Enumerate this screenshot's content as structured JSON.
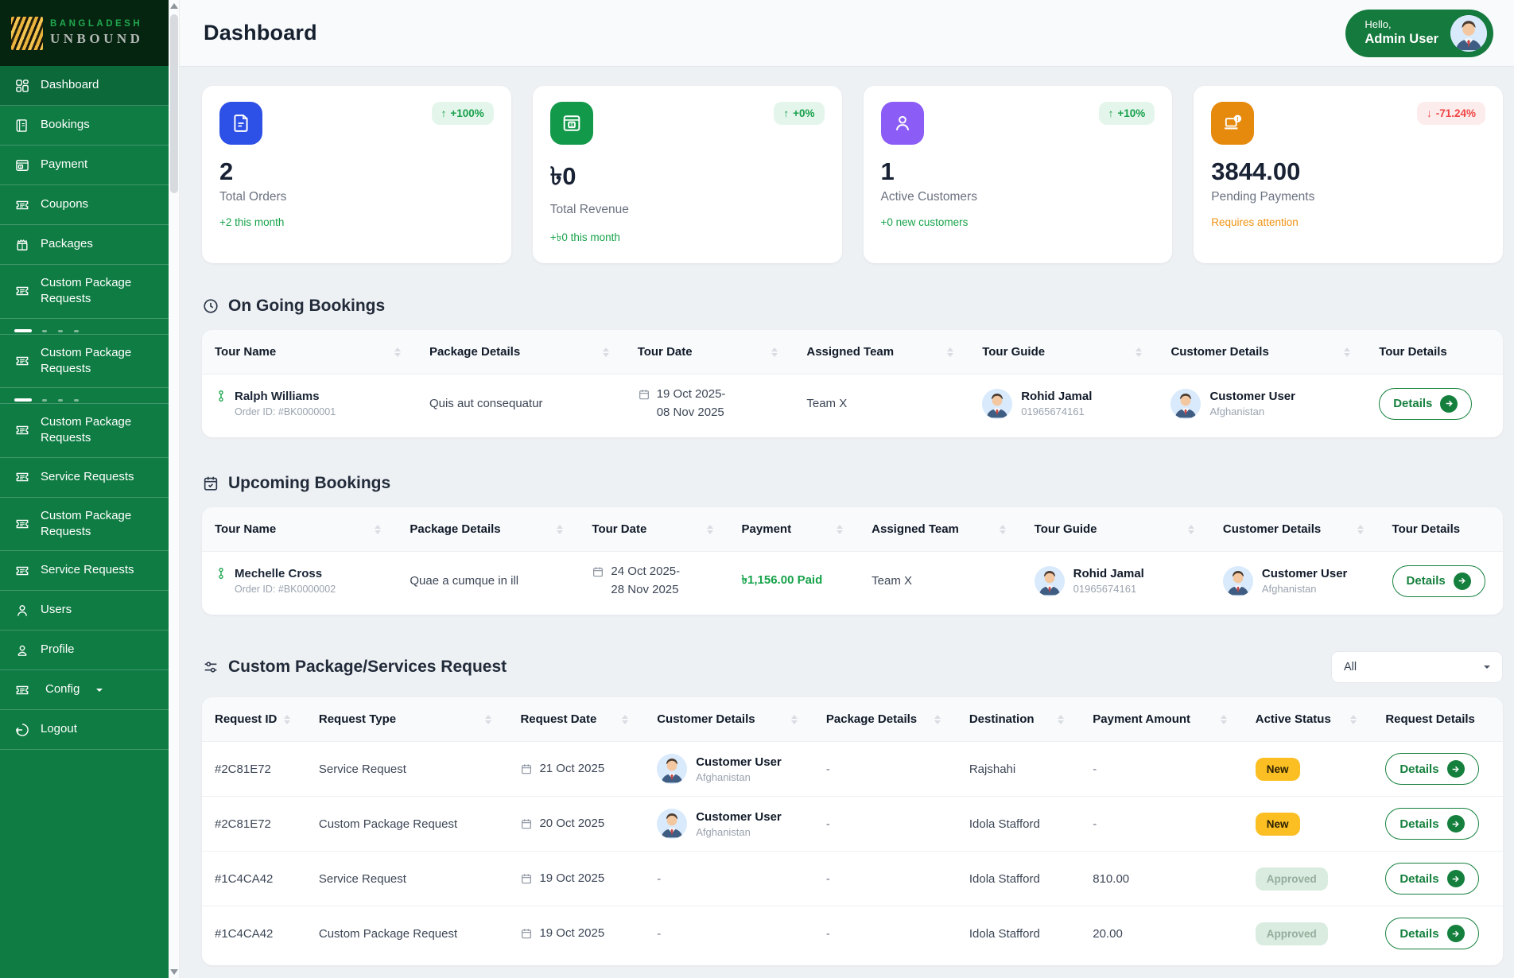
{
  "brand": {
    "top": "BANGLADESH",
    "bottom": "UNBOUND"
  },
  "header": {
    "title": "Dashboard",
    "greeting": "Hello,",
    "user_name": "Admin User"
  },
  "sidebar": {
    "items": [
      {
        "label": "Dashboard",
        "icon": "grid-icon"
      },
      {
        "label": "Bookings",
        "icon": "book-icon"
      },
      {
        "label": "Payment",
        "icon": "payment-icon"
      },
      {
        "label": "Coupons",
        "icon": "ticket-icon"
      },
      {
        "label": "Packages",
        "icon": "gift-icon"
      },
      {
        "label": "Custom Package Requests",
        "icon": "ticket-icon"
      },
      {
        "label": "",
        "icon": "clipped-item"
      },
      {
        "label": "Custom Package Requests",
        "icon": "ticket-icon"
      },
      {
        "label": "",
        "icon": "clipped-item"
      },
      {
        "label": "Custom Package Requests",
        "icon": "ticket-icon"
      },
      {
        "label": "Service Requests",
        "icon": "ticket-icon"
      },
      {
        "label": "Custom Package Requests",
        "icon": "ticket-icon"
      },
      {
        "label": "Service Requests",
        "icon": "ticket-icon"
      },
      {
        "label": "Users",
        "icon": "user-icon"
      },
      {
        "label": "Profile",
        "icon": "profile-icon"
      },
      {
        "label": "Config",
        "icon": "ticket-icon"
      },
      {
        "label": "Logout",
        "icon": "logout-icon"
      }
    ]
  },
  "stats": [
    {
      "badge_dir": "↑",
      "badge": "+100%",
      "value": "2",
      "label": "Total Orders",
      "footer": "+2 this month",
      "icon": "invoice-icon",
      "icon_color": "#2d50e6",
      "trend": "up"
    },
    {
      "badge_dir": "↑",
      "badge": "+0%",
      "value": "৳0",
      "label": "Total Revenue",
      "footer": "+৳0 this month",
      "icon": "revenue-icon",
      "icon_color": "#12994a",
      "trend": "up"
    },
    {
      "badge_dir": "↑",
      "badge": "+10%",
      "value": "1",
      "label": "Active Customers",
      "footer": "+0 new customers",
      "icon": "customer-icon",
      "icon_color": "#8b5cf6",
      "trend": "up"
    },
    {
      "badge_dir": "↓",
      "badge": "-71.24%",
      "value": "3844.00",
      "label": "Pending Payments",
      "footer": "Requires attention",
      "icon": "laptop-alert-icon",
      "icon_color": "#e68a0d",
      "trend": "down"
    }
  ],
  "ongoing": {
    "title": "On Going Bookings",
    "columns": [
      "Tour Name",
      "Package Details",
      "Tour Date",
      "Assigned Team",
      "Tour Guide",
      "Customer Details",
      "Tour Details"
    ],
    "row": {
      "name": "Ralph Williams",
      "order_id": "Order ID: #BK0000001",
      "package": "Quis aut consequatur",
      "date_line1": "19 Oct 2025-",
      "date_line2": "08 Nov 2025",
      "team": "Team X",
      "guide_name": "Rohid Jamal",
      "guide_phone": "01965674161",
      "customer_name": "Customer User",
      "customer_location": "Afghanistan"
    }
  },
  "upcoming": {
    "title": "Upcoming Bookings",
    "columns": [
      "Tour Name",
      "Package Details",
      "Tour Date",
      "Payment",
      "Assigned Team",
      "Tour Guide",
      "Customer Details",
      "Tour Details"
    ],
    "row": {
      "name": "Mechelle Cross",
      "order_id": "Order ID: #BK0000002",
      "package": "Quae a cumque in ill",
      "date_line1": "24 Oct 2025-",
      "date_line2": "28 Nov 2025",
      "payment": "৳1,156.00 Paid",
      "team": "Team X",
      "guide_name": "Rohid Jamal",
      "guide_phone": "01965674161",
      "customer_name": "Customer User",
      "customer_location": "Afghanistan"
    }
  },
  "requests": {
    "title": "Custom Package/Services Request",
    "filter_value": "All",
    "columns": [
      "Request ID",
      "Request Type",
      "Request Date",
      "Customer Details",
      "Package Details",
      "Destination",
      "Payment Amount",
      "Active Status",
      "Request Details"
    ],
    "rows": [
      {
        "id": "#2C81E72",
        "type": "Service Request",
        "date": "21 Oct 2025",
        "customer_name": "Customer User",
        "customer_location": "Afghanistan",
        "package": "-",
        "destination": "Rajshahi",
        "amount": "-",
        "status": "New"
      },
      {
        "id": "#2C81E72",
        "type": "Custom Package Request",
        "date": "20 Oct 2025",
        "customer_name": "Customer User",
        "customer_location": "Afghanistan",
        "package": "-",
        "destination": "Idola Stafford",
        "amount": "-",
        "status": "New"
      },
      {
        "id": "#1C4CA42",
        "type": "Service Request",
        "date": "19 Oct 2025",
        "customer": "-",
        "package": "-",
        "destination": "Idola Stafford",
        "amount": "810.00",
        "status": "Approved"
      },
      {
        "id": "#1C4CA42",
        "type": "Custom Package Request",
        "date": "19 Oct 2025",
        "customer": "-",
        "package": "-",
        "destination": "Idola Stafford",
        "amount": "20.00",
        "status": "Approved"
      }
    ]
  },
  "labels": {
    "details_button": "Details"
  },
  "colors": {
    "sidebar_green": "#0e7c43",
    "sidebar_active": "#0b693a",
    "logo_bg": "#062510",
    "accent_green": "#15803d",
    "brand_green": "#21a84f",
    "stat_blue": "#2d50e6",
    "stat_green": "#12994a",
    "stat_purple": "#8b5cf6",
    "stat_orange": "#e68a0d",
    "chip_up_text": "#18a04b",
    "chip_down_text": "#ef4444",
    "badge_new_bg": "#fbbf24",
    "badge_approved_bg": "#d9ecdf",
    "warn_orange": "#ef9312",
    "paid_green": "#16a34a"
  }
}
